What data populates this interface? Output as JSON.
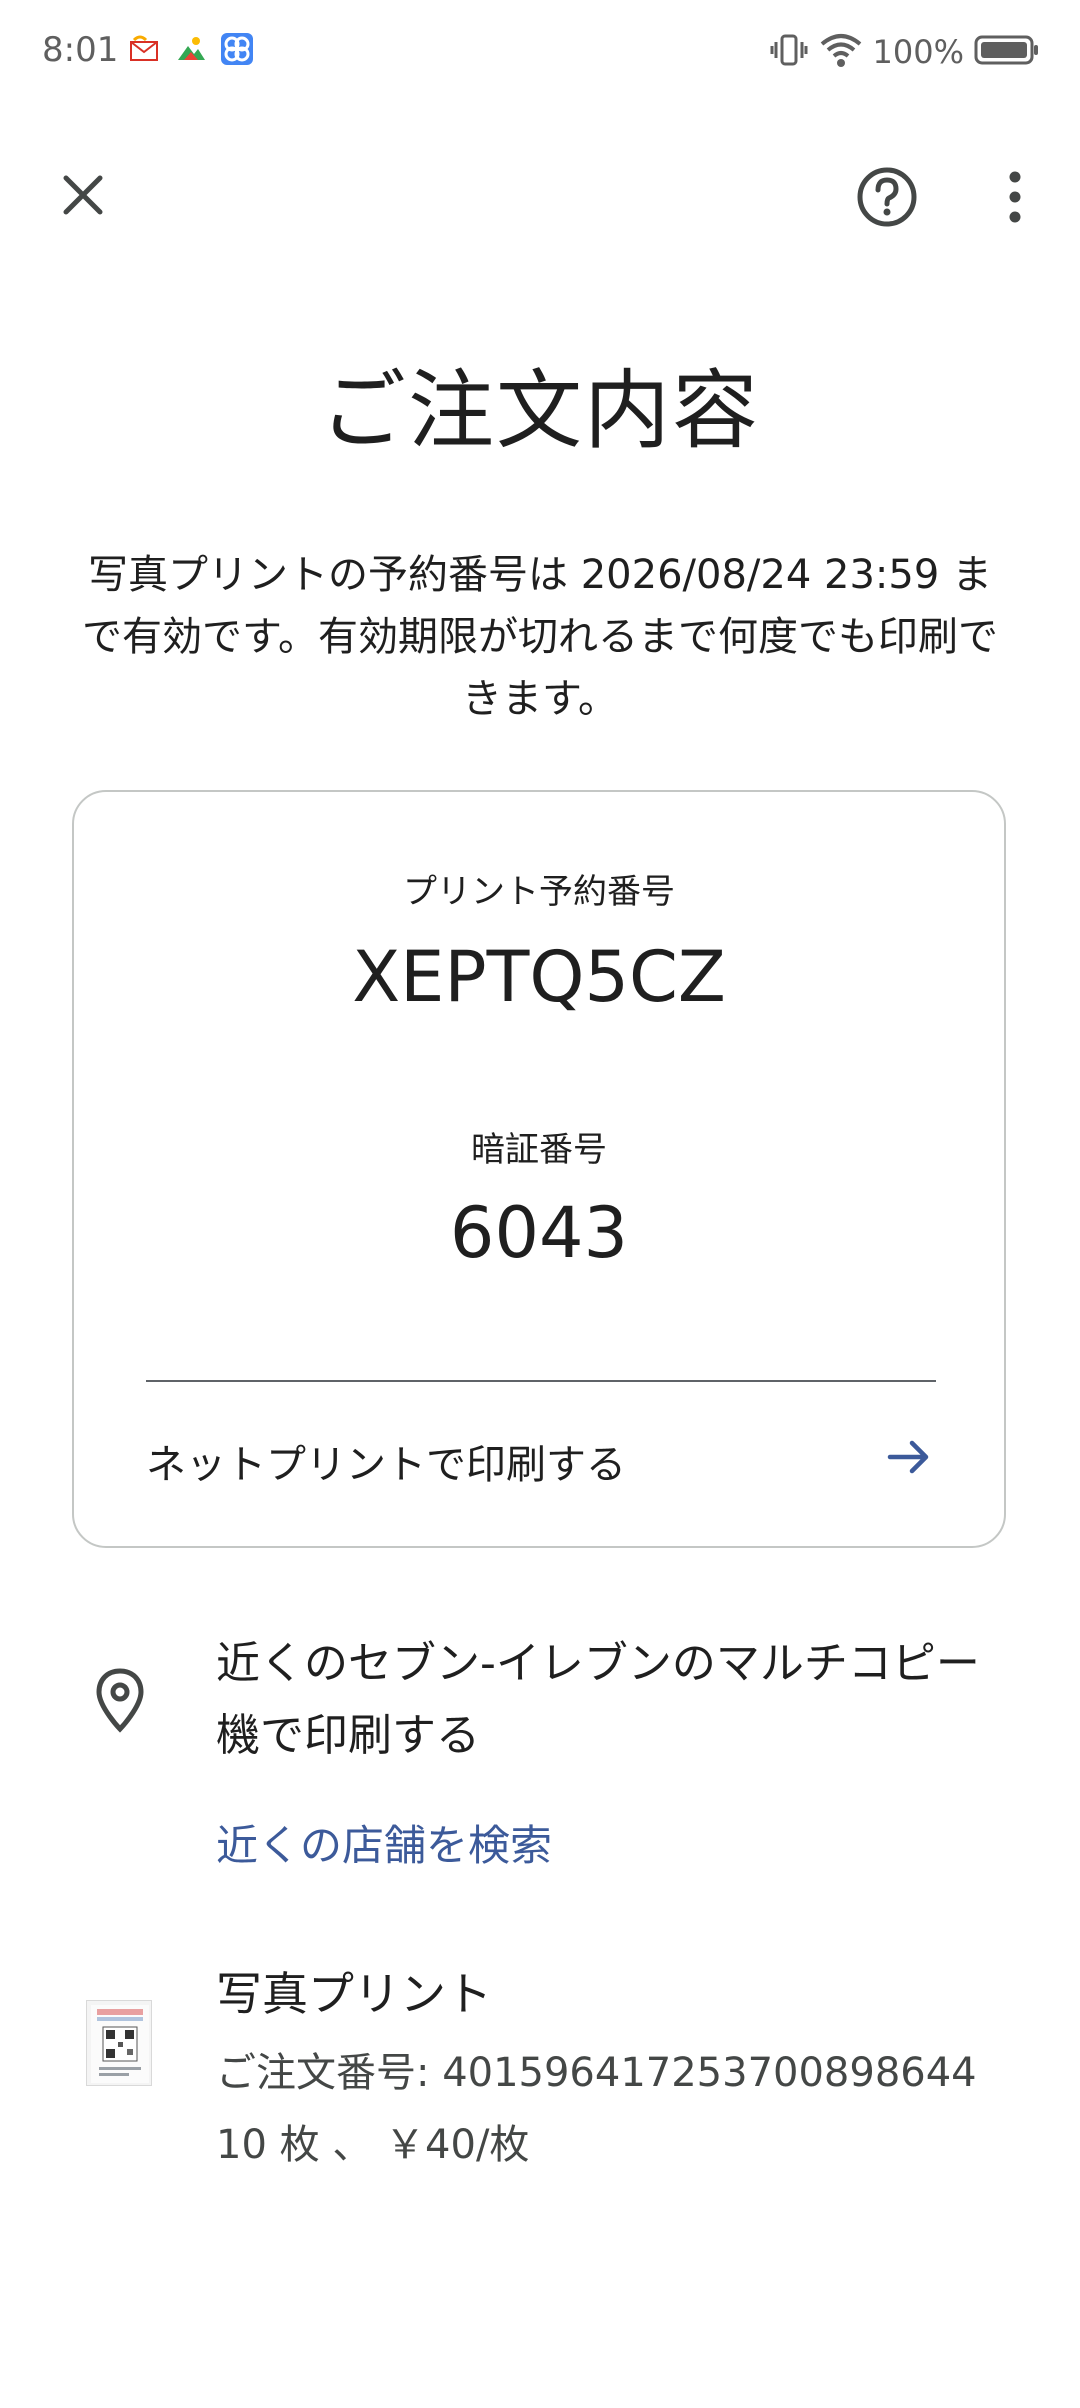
{
  "status_bar": {
    "time": "8:01",
    "battery_text": "100%",
    "icons": [
      "mail-notification-icon",
      "photos-notification-icon",
      "pinwheel-notification-icon",
      "vibrate-icon",
      "wifi-icon",
      "battery-icon"
    ]
  },
  "appbar": {
    "close_icon": "close-icon",
    "help_icon": "help-icon",
    "more_icon": "more-vert-icon"
  },
  "page": {
    "title": "ご注文内容",
    "info": "写真プリントの予約番号は 2026/08/24 23:59 まで有効です。有効期限が切れるまで何度でも印刷できます。"
  },
  "card": {
    "reservation_label": "プリント予約番号",
    "reservation_number": "XEPTQ5CZ",
    "pin_label": "暗証番号",
    "pin": "6043",
    "netprint_link": "ネットプリントで印刷する"
  },
  "store": {
    "text": "近くのセブン-イレブンのマルチコピー機で印刷する",
    "search_link": "近くの店舗を検索"
  },
  "order": {
    "title": "写真プリント",
    "order_number": "ご注文番号: 4015964172537008986​44",
    "quantity_price": "10 枚 、 ￥40/枚"
  },
  "colors": {
    "link_blue": "#3c5a9a",
    "text": "#1f1f1f",
    "card_border": "#c4c7c5"
  }
}
